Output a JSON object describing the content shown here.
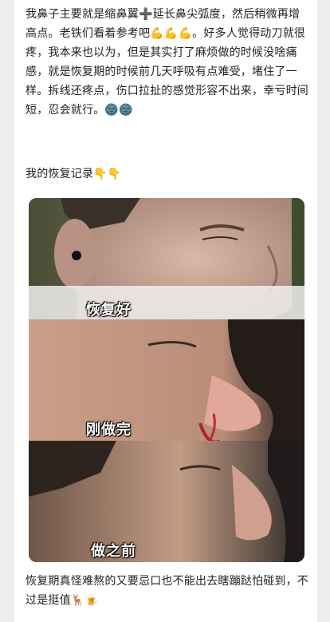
{
  "post": {
    "paragraph1": "我鼻子主要就是缩鼻翼➕延长鼻尖弧度，然后稍微再增高点。老铁们看着参考吧💪💪💪。好多人觉得动刀就很疼，我本来也以为，但是其实打了麻烦做的时候没啥痛感，就是恢复期的时候前几天呼吸有点难受，堵住了一样。拆线还疼点，伤口拉扯的感觉形容不出来，幸亏时间短，忍会就行。🌚🌚",
    "paragraph2": "我的恢复记录👇👇",
    "paragraph3": "恢复期真怪难熬的又要忌口也不能出去瞎蹦跶怕碰到，不过是挺值🦌🍺"
  },
  "photos": {
    "captions": [
      "恢复好",
      "刚做完",
      "做之前"
    ]
  }
}
